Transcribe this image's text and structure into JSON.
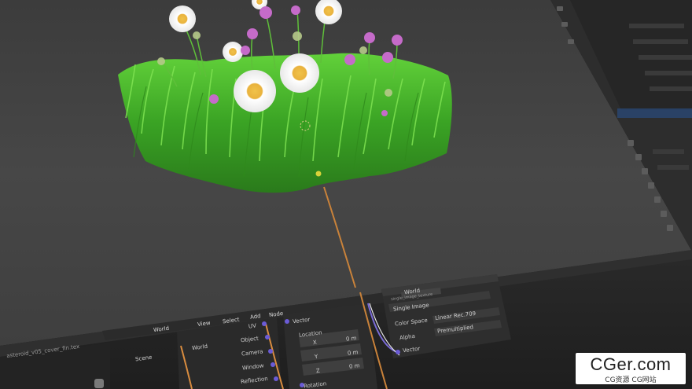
{
  "viewport": {
    "object": "grass-with-daisies-model",
    "background": "#4a4a4a"
  },
  "node_editor": {
    "header": {
      "menu": [
        "View",
        "Select",
        "Add",
        "Node"
      ],
      "world_label": "World",
      "scene_label": "Scene",
      "file_label": "asteroid_v05_cover_fin.tex"
    },
    "texture_coordinate_outputs": [
      "UV",
      "Object",
      "Camera",
      "Window",
      "Reflection"
    ],
    "mapping": {
      "output": "Vector",
      "input_label": "Location",
      "fields": [
        {
          "axis": "X",
          "value": "0 m"
        },
        {
          "axis": "Y",
          "value": "0 m"
        },
        {
          "axis": "Z",
          "value": "0 m"
        }
      ],
      "next_label": "Rotation"
    },
    "image_texture": {
      "image_name": "World",
      "sub_label": "single_image_texture",
      "source": "Single Image",
      "color_space_label": "Color Space",
      "color_space": "Linear Rec.709",
      "alpha_label": "Alpha",
      "alpha": "Premultiplied",
      "socket_label": "Vector"
    }
  },
  "watermark": {
    "main": "CGer.com",
    "sub": "CG资源 CG网站"
  },
  "colors": {
    "grass": "#3fae2a",
    "link_orange": "#c9823a",
    "socket_purple": "#6b5bd6",
    "socket_yellow": "#d8d23a"
  }
}
